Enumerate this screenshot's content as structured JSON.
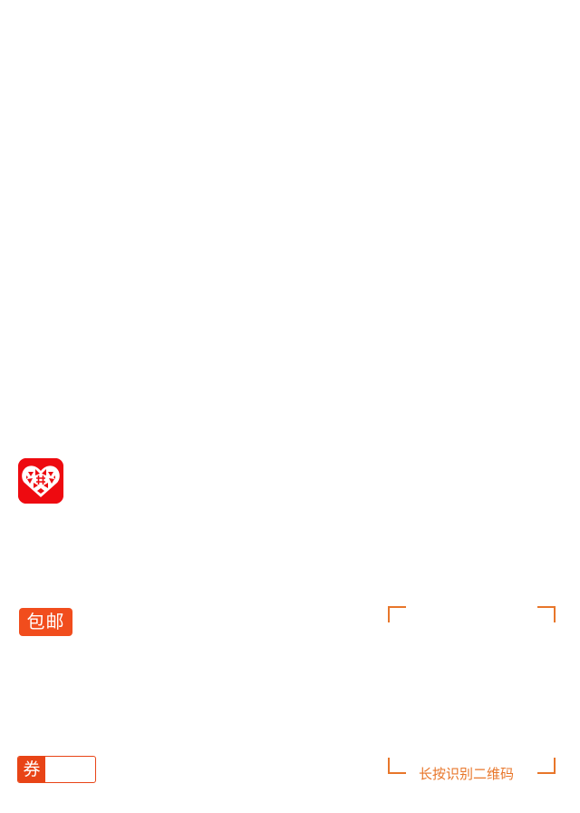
{
  "logo": {
    "icon": "pinduoduo-app-icon",
    "color": "#ee0a10"
  },
  "badge": {
    "label": "包邮",
    "color": "#f14d1d"
  },
  "coupon": {
    "mark": "券",
    "value": "",
    "color": "#e84416"
  },
  "qr": {
    "hint": "长按识别二维码",
    "accent": "#e8762a"
  }
}
